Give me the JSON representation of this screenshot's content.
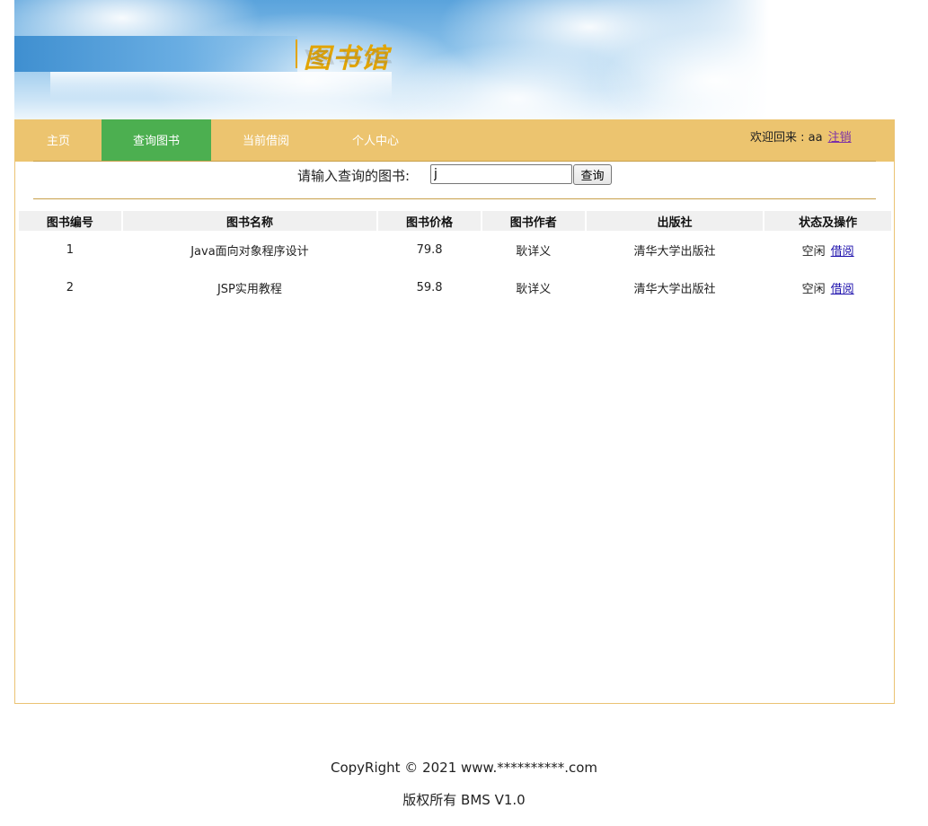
{
  "header": {
    "logo_text": "图书馆"
  },
  "nav": {
    "items": [
      {
        "label": "主页"
      },
      {
        "label": "查询图书"
      },
      {
        "label": "当前借阅"
      },
      {
        "label": "个人中心"
      }
    ],
    "active_index": 1,
    "welcome_text": "欢迎回来 : aa",
    "logout_label": "注销"
  },
  "search": {
    "label": "请输入查询的图书:",
    "value": "j",
    "button_label": "查询"
  },
  "table": {
    "headers": [
      "图书编号",
      "图书名称",
      "图书价格",
      "图书作者",
      "出版社",
      "状态及操作"
    ],
    "rows": [
      {
        "id": "1",
        "name": "Java面向对象程序设计",
        "price": "79.8",
        "author": "耿详义",
        "publisher": "清华大学出版社",
        "status": "空闲",
        "action": "借阅"
      },
      {
        "id": "2",
        "name": "JSP实用教程",
        "price": "59.8",
        "author": "耿详义",
        "publisher": "清华大学出版社",
        "status": "空闲",
        "action": "借阅"
      }
    ]
  },
  "footer": {
    "copyright": "CopyRight © 2021 www.**********.com",
    "rights": "版权所有 BMS V1.0"
  },
  "colors": {
    "nav_background": "#ecc46f",
    "nav_active": "#4caf50",
    "border": "#ebc373",
    "logo": "#e2a400"
  }
}
